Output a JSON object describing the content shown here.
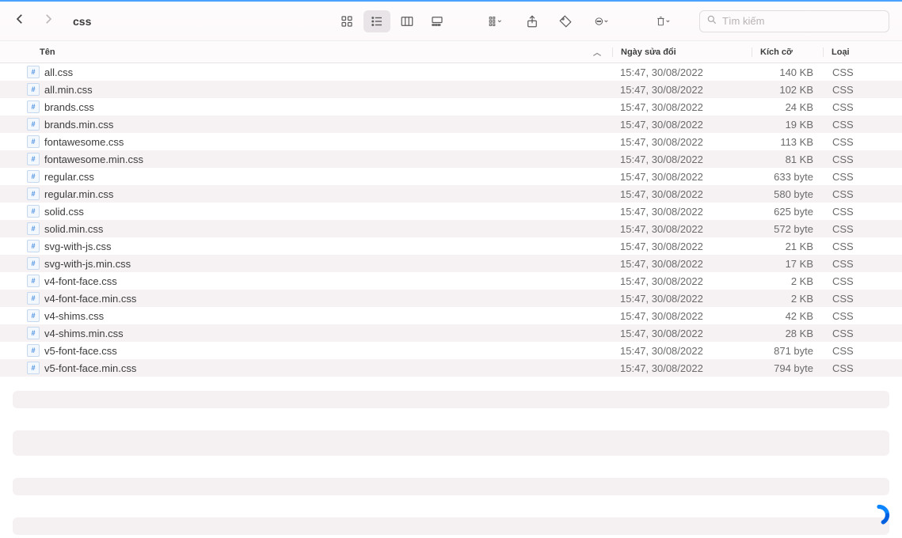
{
  "breadcrumb": "css",
  "search": {
    "placeholder": "Tìm kiếm"
  },
  "columns": {
    "name": "Tên",
    "date": "Ngày sửa đổi",
    "size": "Kích cỡ",
    "kind": "Loại"
  },
  "files": [
    {
      "name": "all.css",
      "date": "15:47, 30/08/2022",
      "size": "140 KB",
      "kind": "CSS"
    },
    {
      "name": "all.min.css",
      "date": "15:47, 30/08/2022",
      "size": "102 KB",
      "kind": "CSS"
    },
    {
      "name": "brands.css",
      "date": "15:47, 30/08/2022",
      "size": "24 KB",
      "kind": "CSS"
    },
    {
      "name": "brands.min.css",
      "date": "15:47, 30/08/2022",
      "size": "19 KB",
      "kind": "CSS"
    },
    {
      "name": "fontawesome.css",
      "date": "15:47, 30/08/2022",
      "size": "113 KB",
      "kind": "CSS"
    },
    {
      "name": "fontawesome.min.css",
      "date": "15:47, 30/08/2022",
      "size": "81 KB",
      "kind": "CSS"
    },
    {
      "name": "regular.css",
      "date": "15:47, 30/08/2022",
      "size": "633 byte",
      "kind": "CSS"
    },
    {
      "name": "regular.min.css",
      "date": "15:47, 30/08/2022",
      "size": "580 byte",
      "kind": "CSS"
    },
    {
      "name": "solid.css",
      "date": "15:47, 30/08/2022",
      "size": "625 byte",
      "kind": "CSS"
    },
    {
      "name": "solid.min.css",
      "date": "15:47, 30/08/2022",
      "size": "572 byte",
      "kind": "CSS"
    },
    {
      "name": "svg-with-js.css",
      "date": "15:47, 30/08/2022",
      "size": "21 KB",
      "kind": "CSS"
    },
    {
      "name": "svg-with-js.min.css",
      "date": "15:47, 30/08/2022",
      "size": "17 KB",
      "kind": "CSS"
    },
    {
      "name": "v4-font-face.css",
      "date": "15:47, 30/08/2022",
      "size": "2 KB",
      "kind": "CSS"
    },
    {
      "name": "v4-font-face.min.css",
      "date": "15:47, 30/08/2022",
      "size": "2 KB",
      "kind": "CSS"
    },
    {
      "name": "v4-shims.css",
      "date": "15:47, 30/08/2022",
      "size": "42 KB",
      "kind": "CSS"
    },
    {
      "name": "v4-shims.min.css",
      "date": "15:47, 30/08/2022",
      "size": "28 KB",
      "kind": "CSS"
    },
    {
      "name": "v5-font-face.css",
      "date": "15:47, 30/08/2022",
      "size": "871 byte",
      "kind": "CSS"
    },
    {
      "name": "v5-font-face.min.css",
      "date": "15:47, 30/08/2022",
      "size": "794 byte",
      "kind": "CSS"
    }
  ]
}
